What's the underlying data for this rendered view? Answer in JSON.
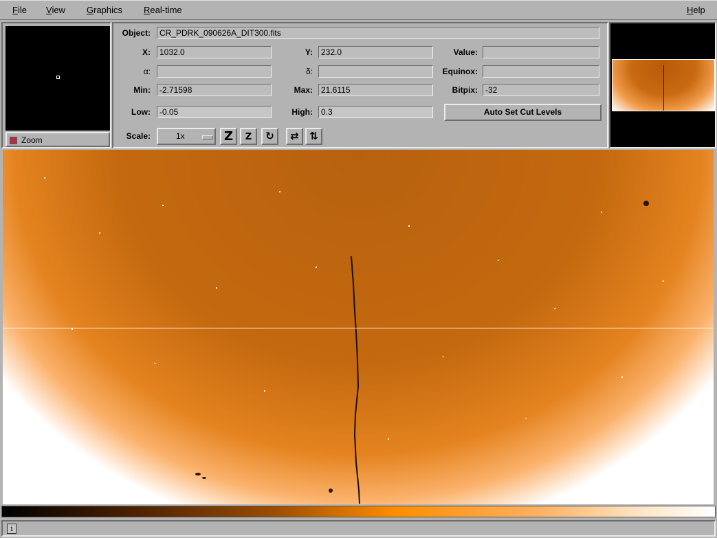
{
  "menu": {
    "file": {
      "mnemonic": "F",
      "rest": "ile"
    },
    "view": {
      "mnemonic": "V",
      "rest": "iew"
    },
    "graphics": {
      "mnemonic": "G",
      "rest": "raphics"
    },
    "realtime": {
      "mnemonic": "R",
      "rest": "eal-time"
    },
    "help": {
      "mnemonic": "H",
      "rest": "elp"
    }
  },
  "zoom": {
    "label": "Zoom",
    "checked": true
  },
  "info": {
    "object_label": "Object:",
    "object_value": "CR_PDRK_090626A_DIT300.fits",
    "x_label": "X:",
    "x_value": "1032.0",
    "y_label": "Y:",
    "y_value": "232.0",
    "value_label": "Value:",
    "value_value": "",
    "alpha_label": "α:",
    "alpha_value": "",
    "delta_label": "δ:",
    "delta_value": "",
    "equinox_label": "Equinox:",
    "equinox_value": "",
    "min_label": "Min:",
    "min_value": "-2.71598",
    "max_label": "Max:",
    "max_value": "21.6115",
    "bitpix_label": "Bitpix:",
    "bitpix_value": "-32",
    "low_label": "Low:",
    "low_value": "-0.05",
    "high_label": "High:",
    "high_value": "0.3",
    "auto_cut_label": "Auto Set Cut Levels",
    "scale_label": "Scale:",
    "scale_value": "1x"
  },
  "toolbar_icons": [
    "zoom-in-icon",
    "zoom-out-icon",
    "rotate-icon",
    "flip-x-icon",
    "flip-y-icon"
  ],
  "colors": {
    "background": "#b3b3b3",
    "image_orange": "#c4690f",
    "colormap_mid": "#ff8c00"
  }
}
